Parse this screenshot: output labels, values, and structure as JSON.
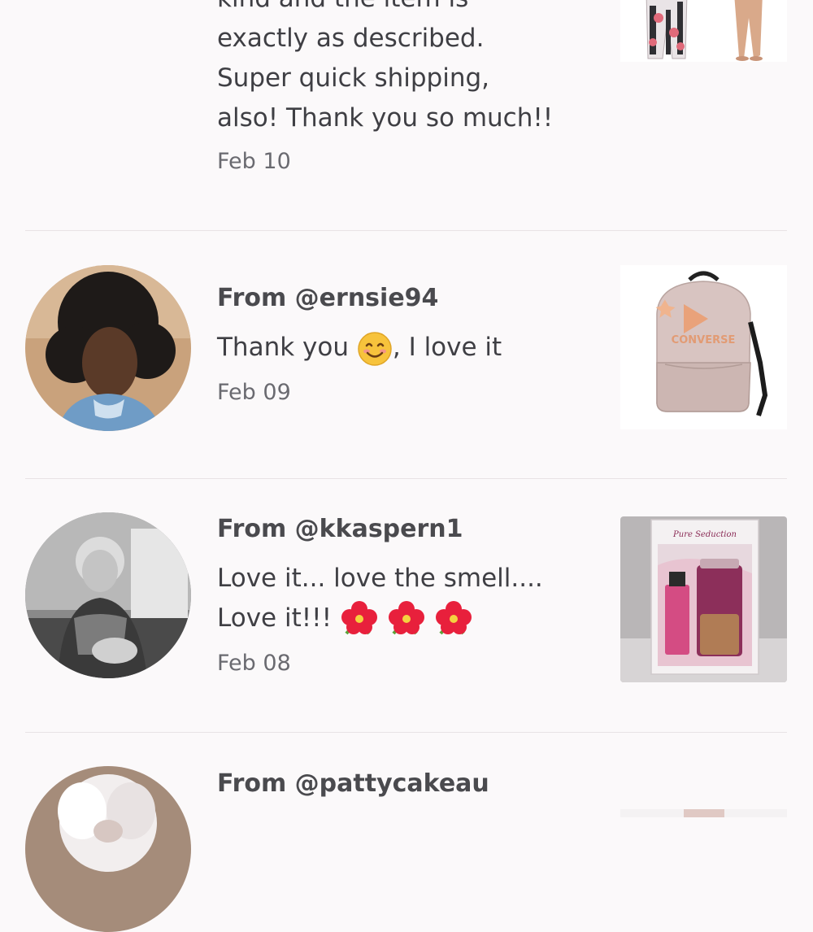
{
  "reviews": [
    {
      "from": "",
      "message_lines": [
        "kind and the item is",
        "exactly as described.",
        "Super quick shipping,",
        "also! Thank you so much!!"
      ],
      "date": "Feb 10",
      "thumb_icon": "pajama-pants-product-image"
    },
    {
      "from": "From @ernsie94",
      "message_before_emoji": "Thank you ",
      "emoji_icon": "smiling-face-emoji",
      "message_after_emoji": ", I love it",
      "date": "Feb 09",
      "thumb_icon": "converse-backpack-product-image",
      "thumb_text": "CONVERSE"
    },
    {
      "from": "From @kkaspern1",
      "message_line1": "Love it... love the smell....",
      "message_line2": "Love it!!! ",
      "emoji_icon": "hibiscus-emoji",
      "date": "Feb 08",
      "thumb_icon": "fragrance-gift-set-product-image",
      "thumb_text": "Pure Seduction"
    },
    {
      "from": "From @pattycakeau"
    }
  ],
  "colors": {
    "background": "#fbf9fa",
    "divider": "#e8e3e5",
    "text": "#444448",
    "date": "#6a6a70"
  }
}
